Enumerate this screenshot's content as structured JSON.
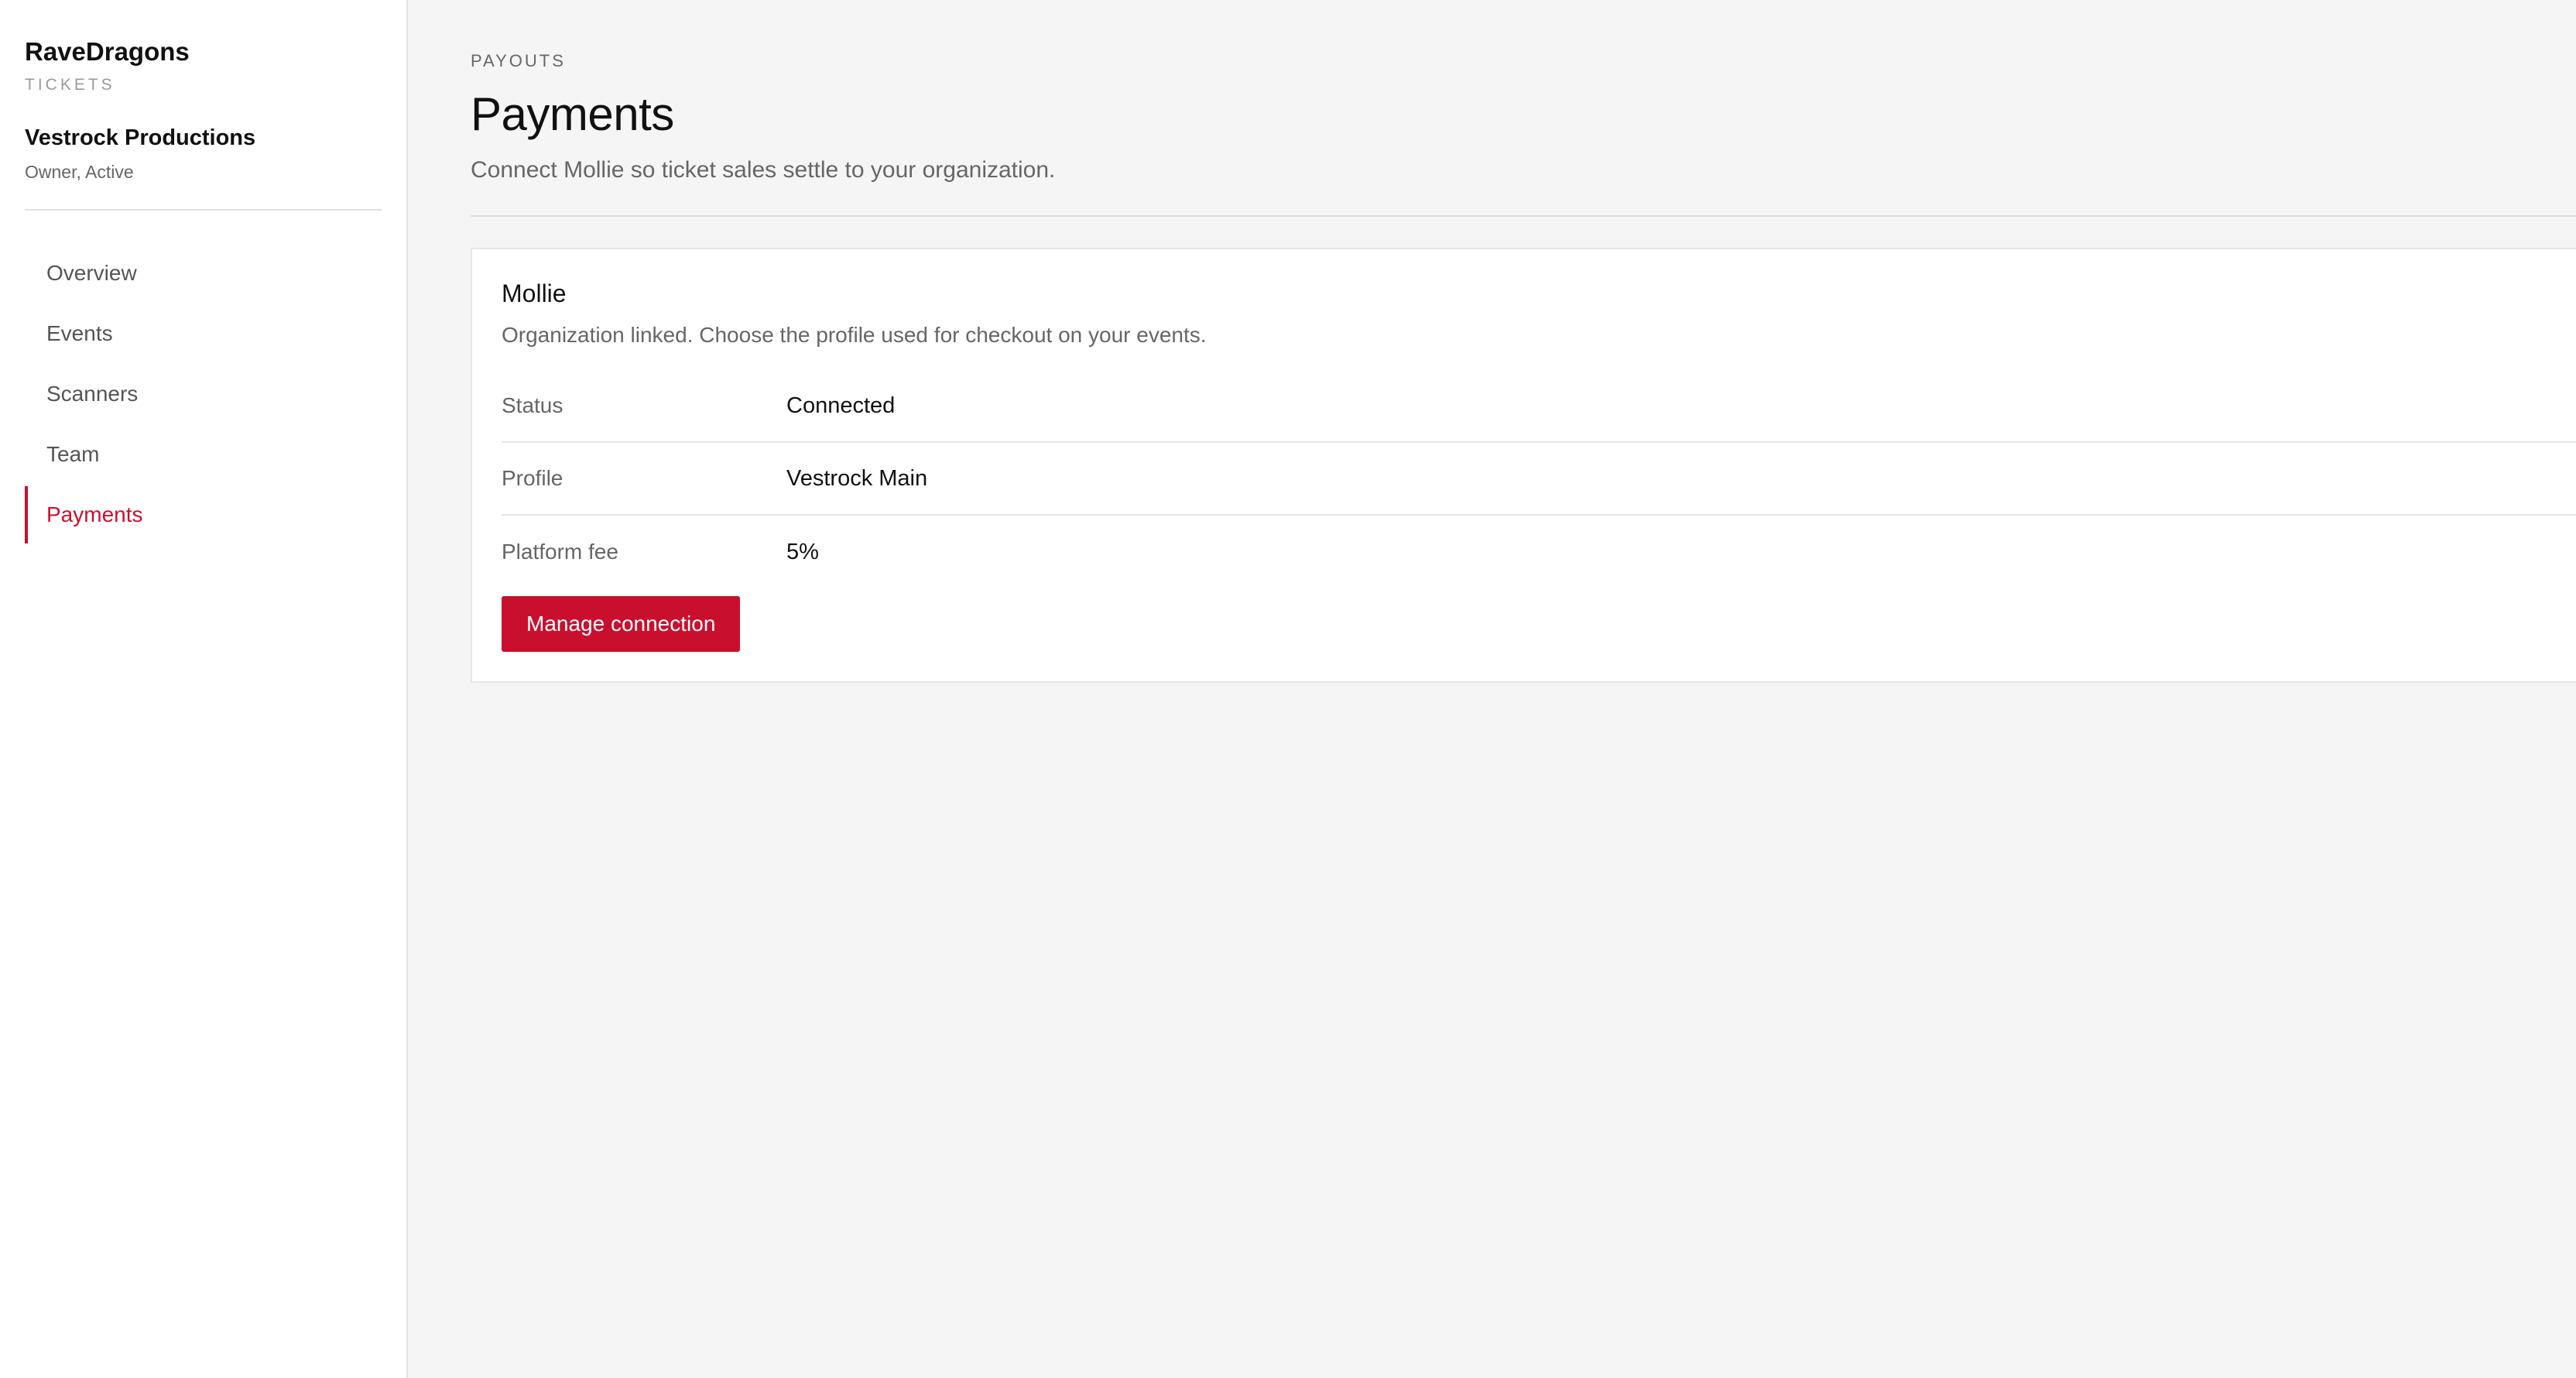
{
  "sidebar": {
    "brand_name": "RaveDragons",
    "brand_sub": "TICKETS",
    "org_name": "Vestrock Productions",
    "org_role": "Owner, Active",
    "items": [
      {
        "label": "Overview"
      },
      {
        "label": "Events"
      },
      {
        "label": "Scanners"
      },
      {
        "label": "Team"
      },
      {
        "label": "Payments",
        "active": true
      }
    ]
  },
  "main": {
    "eyebrow": "PAYOUTS",
    "title": "Payments",
    "description": "Connect Mollie so ticket sales settle to your organization."
  },
  "card": {
    "title": "Mollie",
    "description": "Organization linked. Choose the profile used for checkout on your events.",
    "rows": [
      {
        "label": "Status",
        "value": "Connected"
      },
      {
        "label": "Profile",
        "value": "Vestrock Main"
      },
      {
        "label": "Platform fee",
        "value": "5%"
      }
    ],
    "button_label": "Manage connection"
  },
  "colors": {
    "accent": "#c8102e",
    "background": "#f5f5f5",
    "surface": "#ffffff"
  }
}
